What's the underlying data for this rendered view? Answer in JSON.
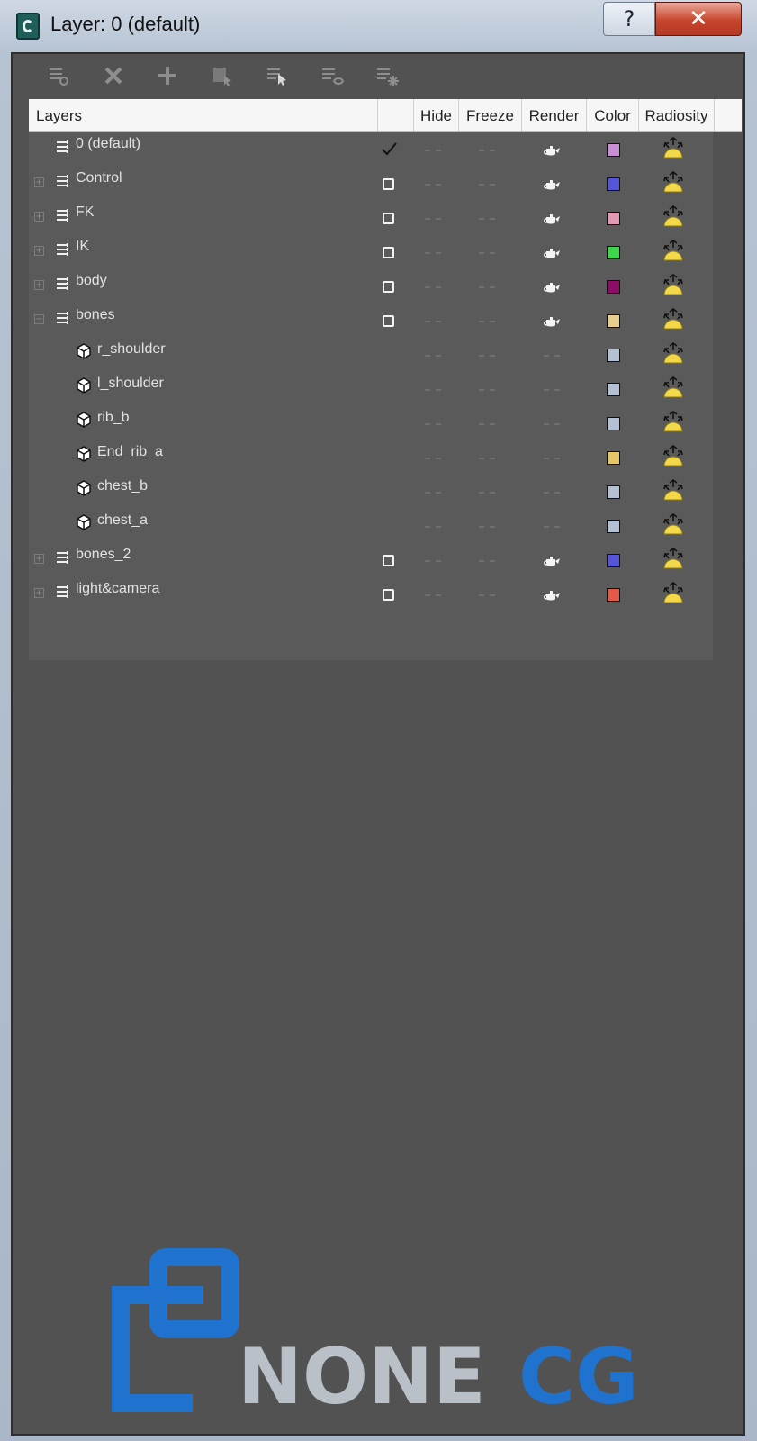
{
  "window": {
    "title": "Layer: 0 (default)",
    "help_label": "?",
    "close_label": "✕"
  },
  "toolbar": [
    {
      "name": "create-new-layer-button",
      "icon": "new-layer-icon"
    },
    {
      "name": "delete-layer-button",
      "icon": "delete-icon"
    },
    {
      "name": "add-to-layer-button",
      "icon": "plus-icon"
    },
    {
      "name": "select-objects-in-layer-button",
      "icon": "select-objects-icon"
    },
    {
      "name": "highlight-selected-layer-button",
      "icon": "highlight-layer-icon"
    },
    {
      "name": "hide-unhide-all-button",
      "icon": "hide-all-icon"
    },
    {
      "name": "freeze-unfreeze-all-button",
      "icon": "freeze-all-icon"
    }
  ],
  "table": {
    "headers": {
      "layers": "Layers",
      "current": "",
      "hide": "Hide",
      "freeze": "Freeze",
      "render": "Render",
      "color": "Color",
      "radiosity": "Radiosity"
    },
    "rows": [
      {
        "name": "0 (default)",
        "kind": "layer",
        "depth": 0,
        "expander": "none",
        "current": "check",
        "render": true,
        "color": "#c98fd3"
      },
      {
        "name": "Control",
        "kind": "layer",
        "depth": 0,
        "expander": "plus",
        "current": "box",
        "render": true,
        "color": "#5555d8"
      },
      {
        "name": "FK",
        "kind": "layer",
        "depth": 0,
        "expander": "plus",
        "current": "box",
        "render": true,
        "color": "#e199b4"
      },
      {
        "name": "IK",
        "kind": "layer",
        "depth": 0,
        "expander": "plus",
        "current": "box",
        "render": true,
        "color": "#3fd64d"
      },
      {
        "name": "body",
        "kind": "layer",
        "depth": 0,
        "expander": "plus",
        "current": "box",
        "render": true,
        "color": "#8a0e66"
      },
      {
        "name": "bones",
        "kind": "layer",
        "depth": 0,
        "expander": "minus",
        "current": "box",
        "render": true,
        "color": "#e6cf8e"
      },
      {
        "name": "r_shoulder",
        "kind": "object",
        "depth": 1,
        "expander": "none",
        "current": "none",
        "render": false,
        "color": "#b5c1d2"
      },
      {
        "name": "l_shoulder",
        "kind": "object",
        "depth": 1,
        "expander": "none",
        "current": "none",
        "render": false,
        "color": "#b5c1d2"
      },
      {
        "name": "rib_b",
        "kind": "object",
        "depth": 1,
        "expander": "none",
        "current": "none",
        "render": false,
        "color": "#b5c1d2"
      },
      {
        "name": "End_rib_a",
        "kind": "object",
        "depth": 1,
        "expander": "none",
        "current": "none",
        "render": false,
        "color": "#e5c76a"
      },
      {
        "name": "chest_b",
        "kind": "object",
        "depth": 1,
        "expander": "none",
        "current": "none",
        "render": false,
        "color": "#b5c1d2"
      },
      {
        "name": "chest_a",
        "kind": "object",
        "depth": 1,
        "expander": "none",
        "current": "none",
        "render": false,
        "color": "#b5c1d2"
      },
      {
        "name": "bones_2",
        "kind": "layer",
        "depth": 0,
        "expander": "plus",
        "current": "box",
        "render": true,
        "color": "#5555d8"
      },
      {
        "name": "light&camera",
        "kind": "layer",
        "depth": 0,
        "expander": "plus",
        "current": "box",
        "render": true,
        "color": "#e25a4a"
      }
    ]
  },
  "watermark": {
    "text_part1": "NONE",
    "text_part2": "CG",
    "colors": {
      "blue": "#1f73cf",
      "gray": "#b9c0c8"
    }
  }
}
